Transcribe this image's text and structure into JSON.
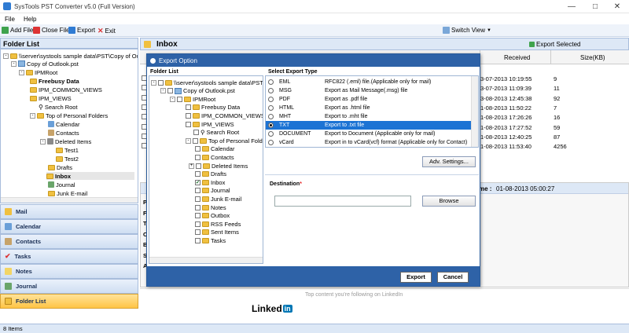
{
  "window": {
    "title": "SysTools PST Converter v5.0 (Full Version)"
  },
  "menu": {
    "file": "File",
    "help": "Help"
  },
  "toolbar": {
    "add_file": "Add File",
    "close_file": "Close File",
    "export": "Export",
    "exit": "Exit",
    "switch_view": "Switch View"
  },
  "folder_list": {
    "title": "Folder List",
    "tree": [
      "\\\\server\\systools sample data\\PST\\Copy of Outl",
      "Copy of Outlook.pst",
      "IPMRoot",
      "Freebusy Data",
      "IPM_COMMON_VIEWS",
      "IPM_VIEWS",
      "Search Root",
      "Top of Personal Folders",
      "Calendar",
      "Contacts",
      "Deleted Items",
      "Test1",
      "Test2",
      "Drafts",
      "Inbox",
      "Journal",
      "Junk E-mail"
    ]
  },
  "nav": {
    "mail": "Mail",
    "calendar": "Calendar",
    "contacts": "Contacts",
    "tasks": "Tasks",
    "notes": "Notes",
    "journal": "Journal",
    "folder_list": "Folder List"
  },
  "status": {
    "items": "8 Items"
  },
  "inbox": {
    "title": "Inbox",
    "export_selected": "Export Selected",
    "col_received": "Received",
    "col_size": "Size(KB)",
    "rows": [
      {
        "received": "3-07-2013 10:19:55",
        "size": "9"
      },
      {
        "received": "3-07-2013 11:09:39",
        "size": "11"
      },
      {
        "received": "3-08-2013 12:45:38",
        "size": "92"
      },
      {
        "received": "1-08-2013 11:50:22",
        "size": "7"
      },
      {
        "received": "1-08-2013 17:26:26",
        "size": "16"
      },
      {
        "received": "1-08-2013 17:27:52",
        "size": "59"
      },
      {
        "received": "1-08-2013 12:40:25",
        "size": "87"
      },
      {
        "received": "1-08-2013 11:53:40",
        "size": "4256"
      }
    ],
    "preview_time_label": "me :",
    "preview_time_value": "01-08-2013 05:00:27",
    "preview_letters": [
      "P",
      "F",
      "T",
      "C",
      "B",
      "S",
      "A"
    ]
  },
  "linkedin": {
    "top_text": "Top content you're following on LinkedIn",
    "logo_text": "Linked",
    "logo_in": "in"
  },
  "export_dialog": {
    "title": "Export Option",
    "folder_list_label": "Folder List",
    "tree": [
      "\\\\server\\systools sample data\\PST\\",
      "Copy of Outlook.pst",
      "IPMRoot",
      "Freebusy Data",
      "IPM_COMMON_VIEWS",
      "IPM_VIEWS",
      "Search Root",
      "Top of Personal Folders",
      "Calendar",
      "Contacts",
      "Deleted Items",
      "Drafts",
      "Inbox",
      "Journal",
      "Junk E-mail",
      "Notes",
      "Outbox",
      "RSS Feeds",
      "Sent Items",
      "Tasks"
    ],
    "select_type_label": "Select Export Type",
    "types": [
      {
        "name": "EML",
        "desc": "RFC822 (.eml) file.(Applicable only for mail)"
      },
      {
        "name": "MSG",
        "desc": "Export as Mail Message(.msg) file"
      },
      {
        "name": "PDF",
        "desc": "Export as .pdf file"
      },
      {
        "name": "HTML",
        "desc": "Export as .html file"
      },
      {
        "name": "MHT",
        "desc": "Export to .mht file"
      },
      {
        "name": "TXT",
        "desc": "Export to .txt file"
      },
      {
        "name": "DOCUMENT",
        "desc": "Export to Document (Applicable only for mail)"
      },
      {
        "name": "vCard",
        "desc": "Export in to vCard(vcf) format (Applicable only for Contact)"
      }
    ],
    "selected_type": "TXT",
    "adv_settings": "Adv. Settings...",
    "destination_label": "Destination",
    "destination_required": "*",
    "destination_value": "",
    "browse": "Browse",
    "export_btn": "Export",
    "cancel_btn": "Cancel"
  }
}
